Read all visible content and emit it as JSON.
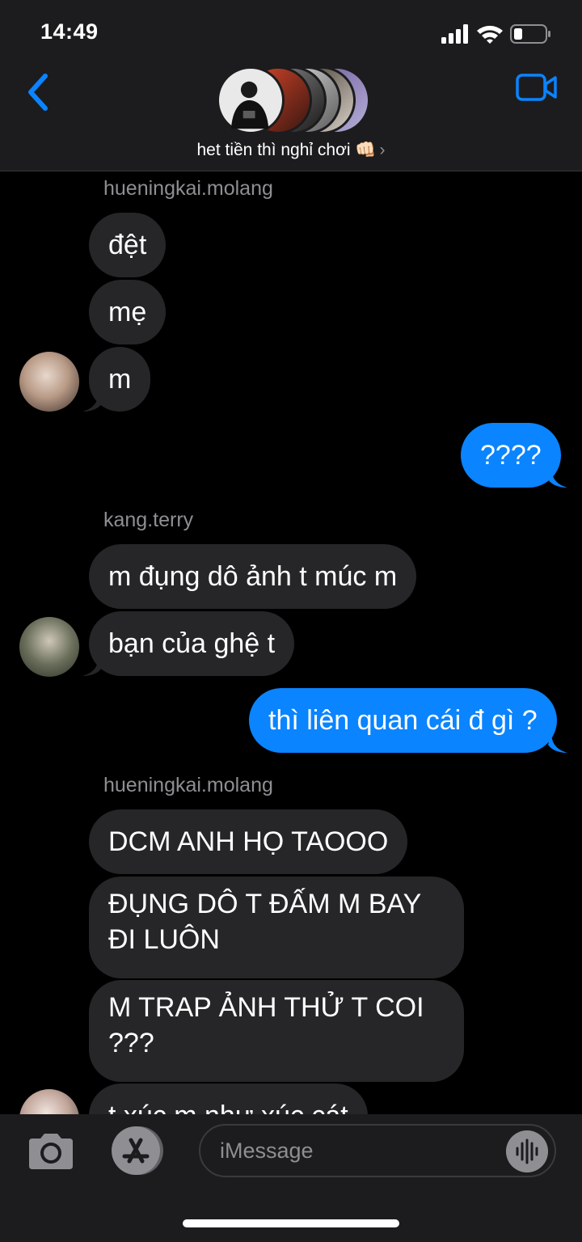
{
  "status": {
    "time": "14:49"
  },
  "header": {
    "group_name": "het tiền thì nghỉ chơi 👊🏻",
    "chevron": "›"
  },
  "messages": {
    "sender1": "hueningkai.molang",
    "m1": "đệt",
    "m2": "mẹ",
    "m3": "m",
    "out1": "????",
    "sender2": "kang.terry",
    "m4": "m đụng dô ảnh t múc m",
    "m5": "bạn của ghệ t",
    "out2": "thì liên quan cái đ gì ?",
    "sender3": "hueningkai.molang",
    "m6": "DCM ANH HỌ TAOOO",
    "m7": "ĐỤNG DÔ T ĐẤM M BAY ĐI LUÔN",
    "m8": "M TRAP ẢNH THỬ T COI ???",
    "m9": "t xúc m như xúc cát"
  },
  "composer": {
    "placeholder": "iMessage"
  },
  "colors": {
    "outgoing": "#0a84ff",
    "incoming": "#262628",
    "accent": "#0a84ff"
  },
  "icons": [
    "signal-icon",
    "wifi-icon",
    "battery-icon",
    "back-chevron-icon",
    "video-call-icon",
    "camera-icon",
    "app-store-icon",
    "audio-waveform-icon"
  ]
}
